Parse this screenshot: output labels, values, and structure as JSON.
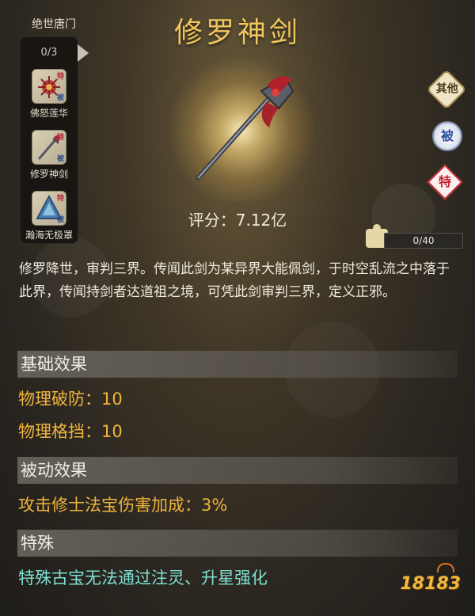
{
  "set": {
    "title": "绝世唐门",
    "count": "0/3",
    "items": [
      {
        "name": "佛怒莲华",
        "tag_top": "特",
        "tag_bottom": "被",
        "icon": "lotus-icon"
      },
      {
        "name": "修罗神剑",
        "tag_top": "特",
        "tag_bottom": "被",
        "icon": "sword-icon"
      },
      {
        "name": "瀚海无极罩",
        "tag_top": "特",
        "tag_bottom": "被",
        "icon": "shield-icon"
      }
    ]
  },
  "item": {
    "title": "修罗神剑",
    "rating": "评分：7.12亿"
  },
  "badges": {
    "other": "其他",
    "passive": "被",
    "special": "特"
  },
  "progress": {
    "text": "0/40",
    "value": 0,
    "max": 40
  },
  "description": "修罗降世，审判三界。传闻此剑为某异界大能佩剑，于时空乱流之中落于此界，传闻持剑者达道祖之境，可凭此剑审判三界，定义正邪。",
  "sections": {
    "basic": {
      "header": "基础效果",
      "stats": [
        "物理破防：10",
        "物理格挡：10"
      ]
    },
    "passive": {
      "header": "被动效果",
      "stats": [
        "攻击修士法宝伤害加成：3%"
      ]
    },
    "special": {
      "header": "特殊",
      "text": "特殊古宝无法通过注灵、升星强化"
    }
  },
  "watermark": "18183",
  "colors": {
    "title": "#f0c75e",
    "stat": "#f0b43c",
    "special": "#7ee0d2"
  }
}
